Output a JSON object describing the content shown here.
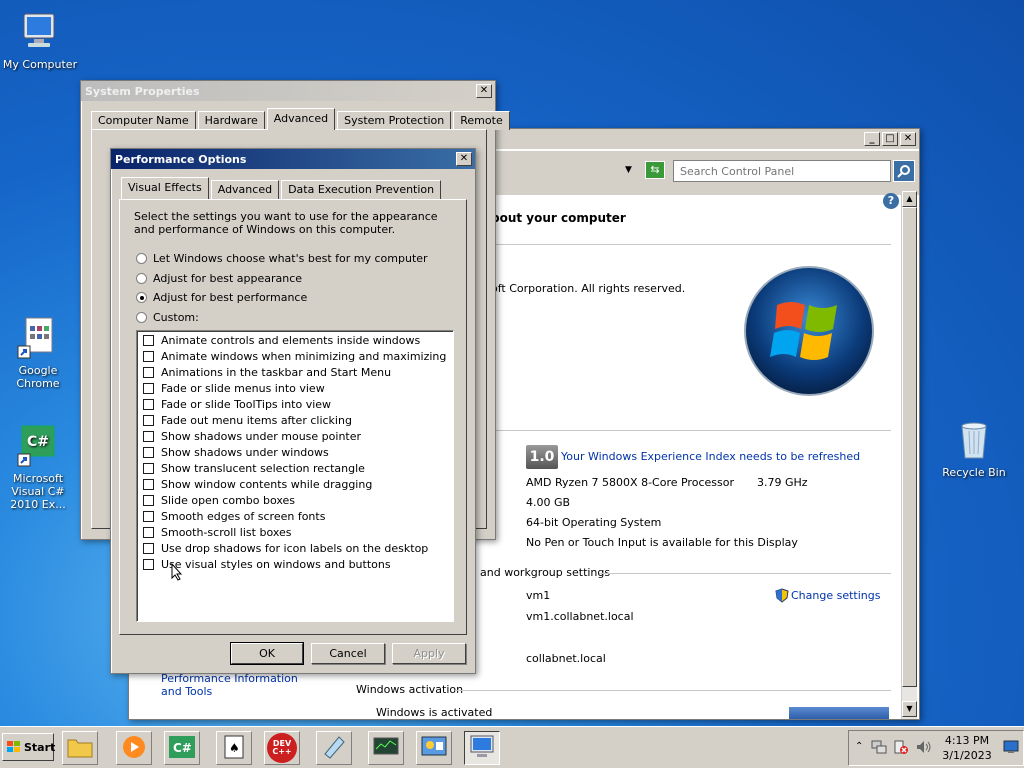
{
  "desktop": {
    "icons": [
      {
        "label": "My Computer"
      },
      {
        "label": "Google Chrome"
      },
      {
        "label": "Microsoft Visual C# 2010 Ex..."
      },
      {
        "label": "Recycle Bin"
      }
    ]
  },
  "system_properties": {
    "title": "System Properties",
    "tabs": [
      "Computer Name",
      "Hardware",
      "Advanced",
      "System Protection",
      "Remote"
    ],
    "selected_tab": "Advanced"
  },
  "control_panel": {
    "search_placeholder": "Search Control Panel",
    "heading_fragment": "bout your computer",
    "copyright_fragment": "oft Corporation.  All rights reserved.",
    "wei": {
      "score": "1.0",
      "link": "Your Windows Experience Index needs to be refreshed"
    },
    "processor": "AMD Ryzen 7 5800X 8-Core Processor",
    "processor_speed": "3.79 GHz",
    "memory": "4.00 GB",
    "system_type": "64-bit Operating System",
    "pen_touch": "No Pen or Touch Input is available for this Display",
    "section_computer_name": "and workgroup settings",
    "computer_name": "vm1",
    "full_computer_name": "vm1.collabnet.local",
    "domain": "collabnet.local",
    "change_settings": "Change settings",
    "section_activation": "Windows activation",
    "activation_status": "Windows is activated",
    "see_also": "Performance Information and Tools"
  },
  "performance_options": {
    "title": "Performance Options",
    "tabs": [
      "Visual Effects",
      "Advanced",
      "Data Execution Prevention"
    ],
    "selected_tab": "Visual Effects",
    "description": "Select the settings you want to use for the appearance and performance of Windows on this computer.",
    "radios": [
      {
        "label": "Let Windows choose what's best for my computer",
        "checked": false
      },
      {
        "label": "Adjust for best appearance",
        "checked": false
      },
      {
        "label": "Adjust for best performance",
        "checked": true
      },
      {
        "label": "Custom:",
        "checked": false
      }
    ],
    "effects": [
      "Animate controls and elements inside windows",
      "Animate windows when minimizing and maximizing",
      "Animations in the taskbar and Start Menu",
      "Fade or slide menus into view",
      "Fade or slide ToolTips into view",
      "Fade out menu items after clicking",
      "Show shadows under mouse pointer",
      "Show shadows under windows",
      "Show translucent selection rectangle",
      "Show window contents while dragging",
      "Slide open combo boxes",
      "Smooth edges of screen fonts",
      "Smooth-scroll list boxes",
      "Use drop shadows for icon labels on the desktop",
      "Use visual styles on windows and buttons"
    ],
    "buttons": {
      "ok": "OK",
      "cancel": "Cancel",
      "apply": "Apply"
    }
  },
  "taskbar": {
    "start_label": "Start",
    "dev_label": "DEV C++",
    "clock_time": "4:13 PM",
    "clock_date": "3/1/2023"
  },
  "colors": {
    "title_active": "#0a246a",
    "link": "#0033aa"
  }
}
